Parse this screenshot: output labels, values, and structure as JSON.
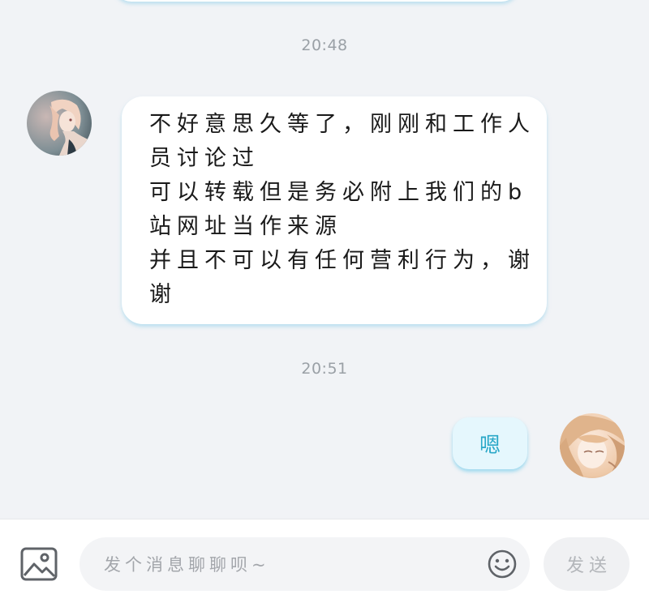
{
  "messages": [
    {
      "timestamp": "20:48",
      "direction": "incoming",
      "avatar_icon": "avatar-girl-icon",
      "lines": [
        "不好意思久等了，刚刚和工作人",
        "员讨论过",
        "可以转载但是务必附上我们的b",
        "站网址当作来源",
        "并且不可以有任何营利行为，谢",
        "谢"
      ]
    },
    {
      "timestamp": "20:51",
      "direction": "outgoing",
      "avatar_icon": "avatar-user-icon",
      "text": "嗯"
    }
  ],
  "composer": {
    "image_icon": "image-icon",
    "placeholder": "发个消息聊聊呗~",
    "value": "",
    "emoji_icon": "emoji-icon",
    "send_label": "发送"
  },
  "colors": {
    "background": "#f1f3f6",
    "incoming_bubble": "#ffffff",
    "outgoing_bubble": "#e5f7fd",
    "outgoing_text": "#2aa8c8",
    "timestamp_text": "#9aa0a6",
    "bubble_shadow": "#96d2eb"
  }
}
